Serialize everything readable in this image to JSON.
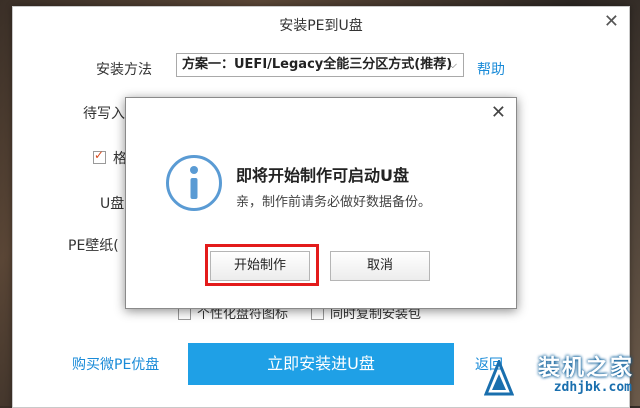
{
  "window": {
    "title": "安装PE到U盘"
  },
  "form": {
    "install_method_label": "安装方法",
    "install_method_value": "方案一：UEFI/Legacy全能三分区方式(推荐)",
    "help_link": "帮助",
    "target_label": "待写入",
    "format_label": "格",
    "udisk_label": "U盘",
    "wallpaper_label": "PE壁纸(",
    "personalize_label": "个性化盘符图标",
    "copy_installer_label": "同时复制安装包"
  },
  "footer": {
    "buy_link": "购买微PE优盘",
    "install_button": "立即安装进U盘",
    "back_link": "返回"
  },
  "modal": {
    "heading": "即将开始制作可启动U盘",
    "message": "亲，制作前请务必做好数据备份。",
    "start_button": "开始制作",
    "cancel_button": "取消"
  },
  "watermark": {
    "main_text": "装机之家",
    "sub_text": "zdhjbk.com"
  },
  "colors": {
    "accent": "#1fa0e6",
    "highlight": "#e31b1b",
    "info_icon": "#5a9bd4"
  }
}
